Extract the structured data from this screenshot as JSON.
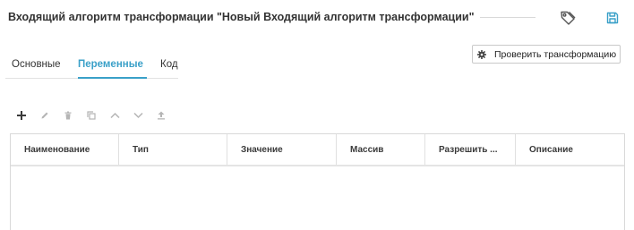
{
  "header": {
    "title": "Входящий алгоритм трансформации \"Новый Входящий алгоритм трансформации\"",
    "tag_icon": "tag-icon",
    "save_icon": "save-icon"
  },
  "actions": {
    "check_label": "Проверить трансформацию",
    "check_icon": "gear-icon"
  },
  "tabs": [
    {
      "label": "Основные",
      "active": false
    },
    {
      "label": "Переменные",
      "active": true
    },
    {
      "label": "Код",
      "active": false
    }
  ],
  "toolbar": [
    {
      "icon": "plus-icon",
      "enabled": true
    },
    {
      "icon": "pencil-icon",
      "enabled": false
    },
    {
      "icon": "trash-icon",
      "enabled": false
    },
    {
      "icon": "copy-icon",
      "enabled": false
    },
    {
      "icon": "chevron-up-icon",
      "enabled": false
    },
    {
      "icon": "chevron-down-icon",
      "enabled": false
    },
    {
      "icon": "upload-icon",
      "enabled": false
    }
  ],
  "table": {
    "columns": [
      "Наименование",
      "Тип",
      "Значение",
      "Массив",
      "Разрешить ...",
      "Описание"
    ],
    "rows": []
  },
  "colors": {
    "accent": "#3aa0c8",
    "text": "#333333",
    "icon_enabled": "#3a3a3a",
    "icon_disabled": "#b5b5b5"
  }
}
